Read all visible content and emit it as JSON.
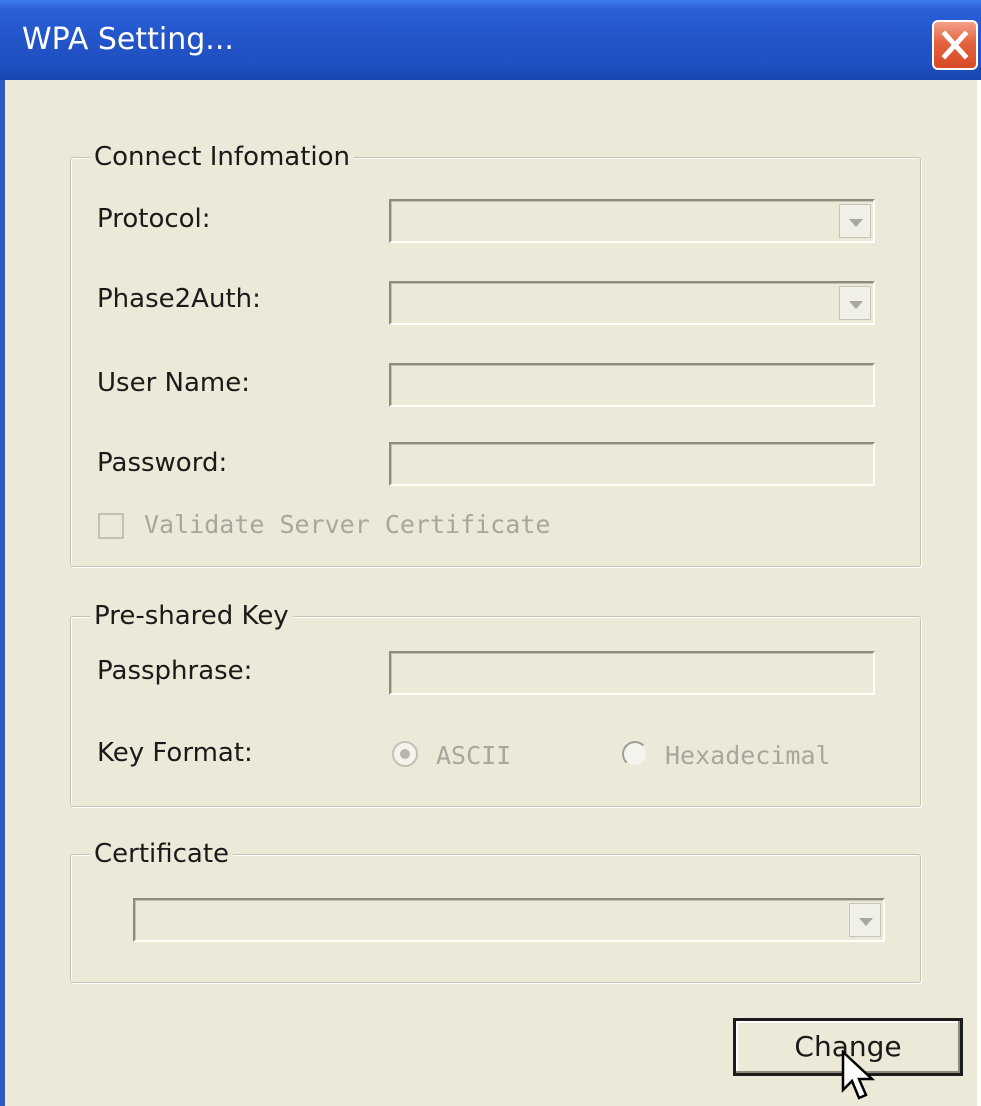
{
  "window": {
    "title": "WPA Setting..."
  },
  "connect_info": {
    "legend": "Connect Infomation",
    "protocol_label": "Protocol:",
    "protocol_value": "",
    "phase2_label": "Phase2Auth:",
    "phase2_value": "",
    "username_label": "User Name:",
    "username_value": "",
    "password_label": "Password:",
    "password_value": "",
    "validate_label": "Validate Server Certificate",
    "validate_checked": false
  },
  "preshared": {
    "legend": "Pre-shared Key",
    "passphrase_label": "Passphrase:",
    "passphrase_value": "",
    "keyformat_label": "Key Format:",
    "ascii_label": "ASCII",
    "hex_label": "Hexadecimal",
    "selected_format": "ASCII"
  },
  "certificate": {
    "legend": "Certificate",
    "value": ""
  },
  "buttons": {
    "change_label": "Change"
  },
  "icons": {
    "close": "close-icon",
    "dropdown": "chevron-down-icon",
    "cursor": "mouse-cursor-icon"
  },
  "colors": {
    "titlebar": "#2355c9",
    "close_button": "#d94a26",
    "dialog_background": "#ece9d8",
    "disabled_text": "#a9a79d"
  }
}
